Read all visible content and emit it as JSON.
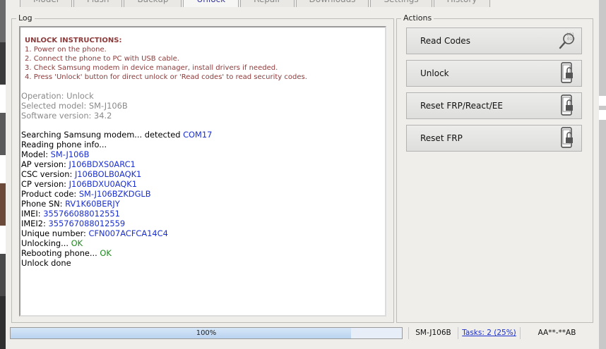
{
  "tabs": [
    {
      "label": "Model",
      "active": false
    },
    {
      "label": "Flash",
      "active": false
    },
    {
      "label": "Backup",
      "active": false
    },
    {
      "label": "Unlock",
      "active": true
    },
    {
      "label": "Repair",
      "active": false
    },
    {
      "label": "Downloads",
      "active": false
    },
    {
      "label": "Settings",
      "active": false
    },
    {
      "label": "History",
      "active": false
    }
  ],
  "log": {
    "title": "Log",
    "instructions": {
      "heading": "UNLOCK INSTRUCTIONS:",
      "steps": [
        "1. Power on the phone.",
        "2. Connect the phone to PC with USB cable.",
        "3. Check Samsung modem in device manager, install drivers if needed.",
        "4. Press 'Unlock' button for direct unlock or 'Read codes' to read security codes."
      ]
    },
    "operation": "Operation: Unlock",
    "selected_model": "Selected model: SM-J106B",
    "software_version": "Software version: 34.2",
    "entries": [
      {
        "label": "Searching Samsung modem... detected ",
        "value": "COM17",
        "kind": "value"
      },
      {
        "label": "Reading phone info...",
        "value": "",
        "kind": "value"
      },
      {
        "label": "Model: ",
        "value": "SM-J106B",
        "kind": "value"
      },
      {
        "label": "AP version: ",
        "value": "J106BDXS0ARC1",
        "kind": "value"
      },
      {
        "label": "CSC version: ",
        "value": "J106BOLB0AQK1",
        "kind": "value"
      },
      {
        "label": "CP version: ",
        "value": "J106BDXU0AQK1",
        "kind": "value"
      },
      {
        "label": "Product code: ",
        "value": "SM-J106BZKDGLB",
        "kind": "value"
      },
      {
        "label": "Phone SN: ",
        "value": "RV1K60BERJY",
        "kind": "value"
      },
      {
        "label": "IMEI: ",
        "value": "355766088012551",
        "kind": "value"
      },
      {
        "label": "IMEI2: ",
        "value": "355767088012559",
        "kind": "value"
      },
      {
        "label": "Unique number: ",
        "value": "CFN007ACFCA14C4",
        "kind": "value"
      },
      {
        "label": "Unlocking... ",
        "value": "OK",
        "kind": "ok"
      },
      {
        "label": "Rebooting phone... ",
        "value": "OK",
        "kind": "ok"
      },
      {
        "label": "Unlock done",
        "value": "",
        "kind": "value"
      }
    ]
  },
  "actions": {
    "title": "Actions",
    "buttons": [
      {
        "label": "Read Codes",
        "icon": "magnifier-binary-icon"
      },
      {
        "label": "Unlock",
        "icon": "phone-unlock-icon"
      },
      {
        "label": "Reset FRP/React/EE",
        "icon": "phone-unlock-icon"
      },
      {
        "label": "Reset FRP",
        "icon": "phone-unlock-icon"
      }
    ]
  },
  "status": {
    "progress_text": "100%",
    "progress": 0.87,
    "model": "SM-J106B",
    "tasks": "Tasks: 2 (25%)",
    "code": "AA**-**AB"
  },
  "colors": {
    "value_blue": "#1a2fd0",
    "ok_green": "#1d8a1d",
    "instruction_red": "#8b3a3a"
  }
}
